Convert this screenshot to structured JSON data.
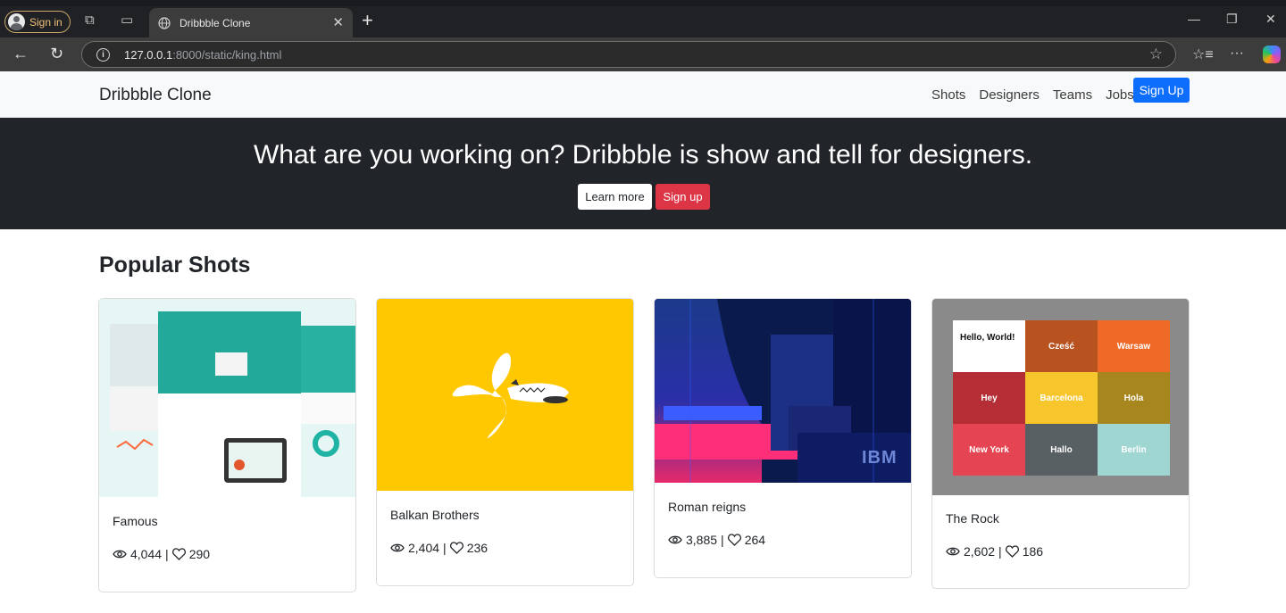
{
  "browser": {
    "profile_label": "Sign in",
    "tab_title": "Dribbble Clone",
    "url_host": "127.0.0.1",
    "url_rest": ":8000/static/king.html"
  },
  "nav": {
    "brand": "Dribbble Clone",
    "links": [
      "Shots",
      "Designers",
      "Teams",
      "Jobs"
    ],
    "signup": "Sign Up"
  },
  "hero": {
    "title": "What are you working on? Dribbble is show and tell for designers.",
    "learn_more": "Learn more",
    "signup": "Sign up"
  },
  "section": {
    "title": "Popular Shots"
  },
  "shots": [
    {
      "title": "Famous",
      "views": "4,044",
      "likes": "290"
    },
    {
      "title": "Balkan Brothers",
      "views": "2,404",
      "likes": "236"
    },
    {
      "title": "Roman reigns",
      "views": "3,885",
      "likes": "264"
    },
    {
      "title": "The Rock",
      "views": "2,602",
      "likes": "186"
    }
  ],
  "rock_tiles": [
    "Hello, World!",
    "Cześć",
    "Warsaw",
    "Hey",
    "Barcelona",
    "Hola",
    "New York",
    "Hallo",
    "Berlin"
  ],
  "ibm_text": "IBM",
  "colors": {
    "primary": "#0d6efd",
    "danger": "#dc3545",
    "hero_bg": "#212529",
    "balkan_yellow": "#ffc800"
  }
}
